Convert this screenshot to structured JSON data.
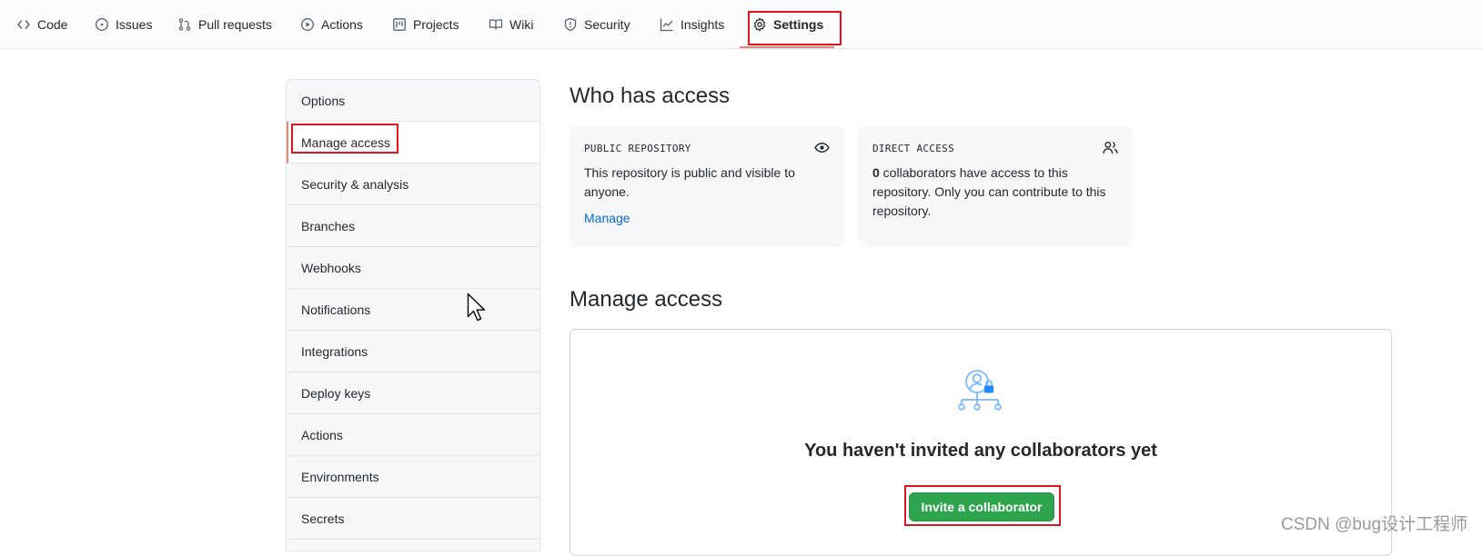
{
  "nav": {
    "tabs": [
      {
        "label": "Code",
        "icon": "code-icon"
      },
      {
        "label": "Issues",
        "icon": "issue-icon"
      },
      {
        "label": "Pull requests",
        "icon": "pull-request-icon"
      },
      {
        "label": "Actions",
        "icon": "play-icon"
      },
      {
        "label": "Projects",
        "icon": "project-icon"
      },
      {
        "label": "Wiki",
        "icon": "book-icon"
      },
      {
        "label": "Security",
        "icon": "shield-icon"
      },
      {
        "label": "Insights",
        "icon": "graph-icon"
      },
      {
        "label": "Settings",
        "icon": "gear-icon",
        "selected": true
      }
    ]
  },
  "menu": {
    "items": [
      {
        "label": "Options"
      },
      {
        "label": "Manage access",
        "active": true
      },
      {
        "label": "Security & analysis"
      },
      {
        "label": "Branches"
      },
      {
        "label": "Webhooks"
      },
      {
        "label": "Notifications"
      },
      {
        "label": "Integrations"
      },
      {
        "label": "Deploy keys"
      },
      {
        "label": "Actions"
      },
      {
        "label": "Environments"
      },
      {
        "label": "Secrets"
      }
    ]
  },
  "who_has_access": {
    "heading": "Who has access",
    "public_card": {
      "header": "PUBLIC REPOSITORY",
      "icon": "eye-icon",
      "text": "This repository is public and visible to anyone.",
      "link": "Manage"
    },
    "direct_card": {
      "header": "DIRECT ACCESS",
      "icon": "people-icon",
      "count": "0",
      "text": " collaborators have access to this repository. Only you can contribute to this repository."
    }
  },
  "manage_access": {
    "heading": "Manage access",
    "empty_icon": "collaborator-lock-icon",
    "empty_title": "You haven't invited any collaborators yet",
    "invite_button": "Invite a collaborator"
  },
  "watermark": "CSDN @bug设计工程师",
  "colors": {
    "accent_underline": "#f9826c",
    "highlight_box": "#e0141e",
    "link": "#0366d6",
    "primary_button": "#2ea44f"
  }
}
